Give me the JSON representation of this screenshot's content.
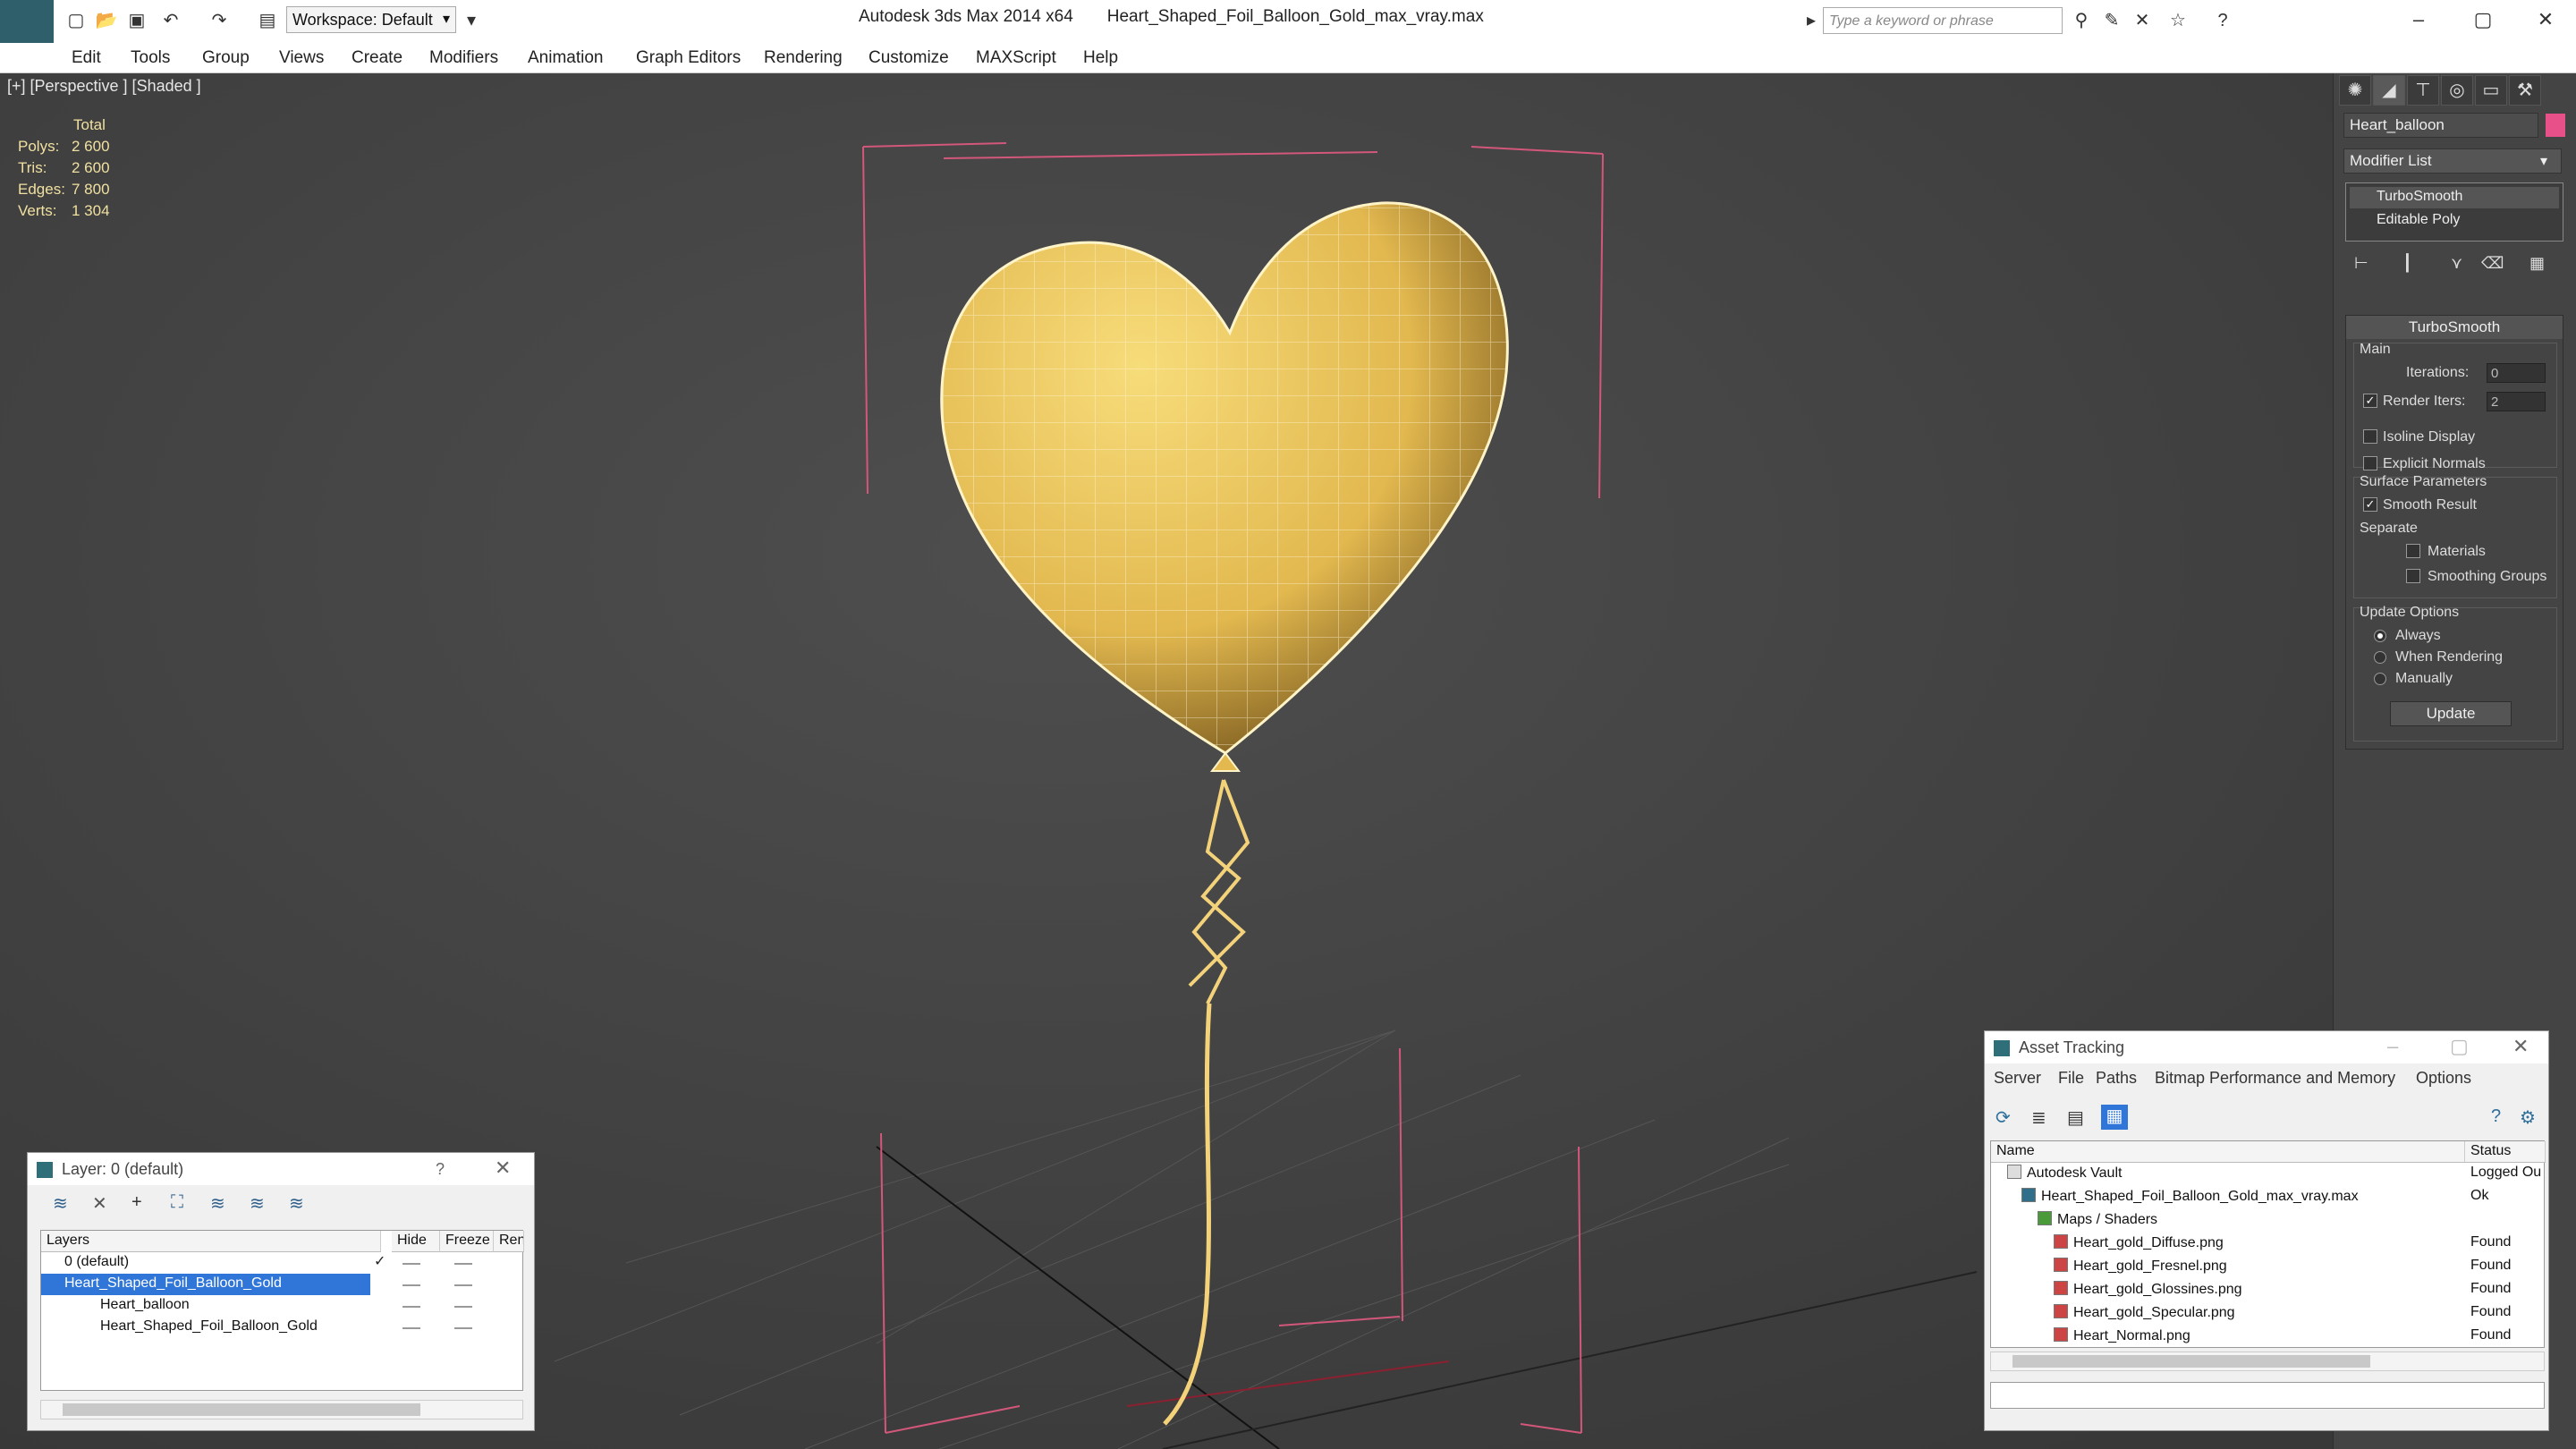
{
  "titlebar": {
    "app_title": "Autodesk 3ds Max  2014 x64",
    "file_name": "Heart_Shaped_Foil_Balloon_Gold_max_vray.max",
    "workspace": "Workspace: Default",
    "search_placeholder": "Type a keyword or phrase"
  },
  "menu": [
    "Edit",
    "Tools",
    "Group",
    "Views",
    "Create",
    "Modifiers",
    "Animation",
    "Graph Editors",
    "Rendering",
    "Customize",
    "MAXScript",
    "Help"
  ],
  "viewport": {
    "label": "[+] [Perspective ] [Shaded ]",
    "stats": {
      "header": "Total",
      "rows": [
        {
          "k": "Polys:",
          "v": "2 600"
        },
        {
          "k": "Tris:",
          "v": "2 600"
        },
        {
          "k": "Edges:",
          "v": "7 800"
        },
        {
          "k": "Verts:",
          "v": "1 304"
        }
      ]
    },
    "balloon_color": "#e9c15e",
    "bbox_color": "#d2577a"
  },
  "command_panel": {
    "object_name": "Heart_balloon",
    "object_color": "#e8508a",
    "modifier_list": "Modifier List",
    "stack": [
      "TurboSmooth",
      "Editable Poly"
    ],
    "rollout_title": "TurboSmooth",
    "main_label": "Main",
    "iterations_label": "Iterations:",
    "iterations_value": "0",
    "render_iters_label": "Render Iters:",
    "render_iters_value": "2",
    "isoline_label": "Isoline Display",
    "explicit_normals_label": "Explicit Normals",
    "surface_params_label": "Surface Parameters",
    "smooth_result_label": "Smooth Result",
    "separate_label": "Separate",
    "materials_label": "Materials",
    "smoothing_groups_label": "Smoothing Groups",
    "update_options_label": "Update Options",
    "always_label": "Always",
    "when_rendering_label": "When Rendering",
    "manually_label": "Manually",
    "update_button": "Update"
  },
  "layer_dialog": {
    "title": "Layer: 0 (default)",
    "help": "?",
    "columns": [
      "Layers",
      "Hide",
      "Freeze",
      "Rend"
    ],
    "rows": [
      {
        "name": "0 (default)"
      },
      {
        "name": "Heart_Shaped_Foil_Balloon_Gold"
      },
      {
        "name": "Heart_balloon"
      },
      {
        "name": "Heart_Shaped_Foil_Balloon_Gold"
      }
    ]
  },
  "asset_tracking": {
    "title": "Asset Tracking",
    "menu": [
      "Server",
      "File",
      "Paths",
      "Bitmap Performance and Memory",
      "Options"
    ],
    "columns": [
      "Name",
      "Status"
    ],
    "rows": [
      {
        "name": "Autodesk Vault",
        "status": "Logged Ou"
      },
      {
        "name": "Heart_Shaped_Foil_Balloon_Gold_max_vray.max",
        "status": "Ok"
      },
      {
        "name": "Maps / Shaders",
        "status": ""
      },
      {
        "name": "Heart_gold_Diffuse.png",
        "status": "Found"
      },
      {
        "name": "Heart_gold_Fresnel.png",
        "status": "Found"
      },
      {
        "name": "Heart_gold_Glossines.png",
        "status": "Found"
      },
      {
        "name": "Heart_gold_Specular.png",
        "status": "Found"
      },
      {
        "name": "Heart_Normal.png",
        "status": "Found"
      }
    ]
  }
}
